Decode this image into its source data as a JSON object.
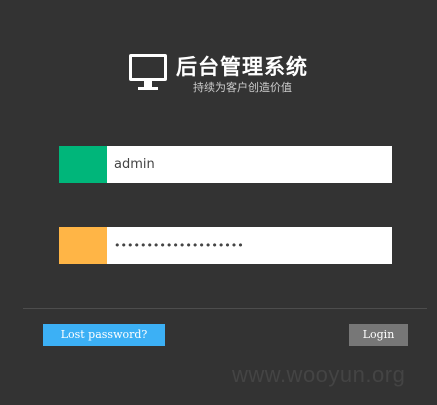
{
  "brand": {
    "title": "后台管理系统",
    "subtitle": "持续为客户创造价值",
    "icon": "monitor-icon"
  },
  "login_form": {
    "username_value": "admin",
    "password_value": "••••••••••••••••••••",
    "username_accent": "#00b67a",
    "password_accent": "#ffb546"
  },
  "actions": {
    "lost_password_label": "Lost password?",
    "login_label": "Login",
    "lost_password_color": "#3cb0f5",
    "login_color": "#777777"
  },
  "watermark": {
    "text": "www.wooyun.org"
  },
  "colors": {
    "background": "#333333"
  }
}
